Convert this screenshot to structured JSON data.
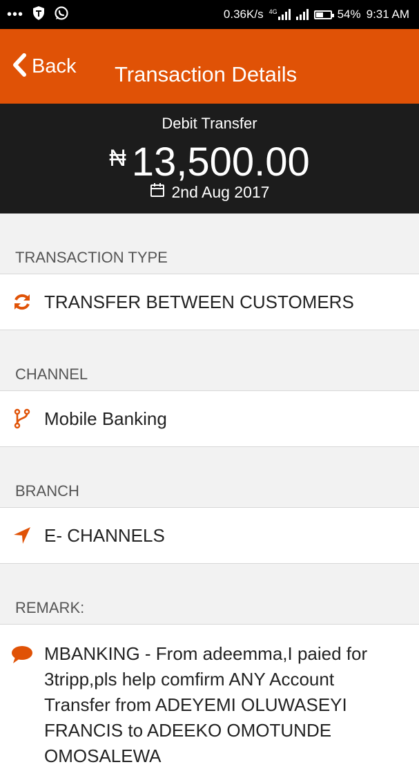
{
  "status_bar": {
    "speed": "0.36K/s",
    "network": "4G",
    "battery": "54%",
    "battery_level": 0.54,
    "time": "9:31 AM",
    "icons": [
      "more-dots-icon",
      "shield-vpn-icon",
      "whatsapp-icon"
    ]
  },
  "app_bar": {
    "back_label": "Back",
    "title": "Transaction Details"
  },
  "summary": {
    "type": "Debit Transfer",
    "currency_symbol": "₦",
    "amount": "13,500.00",
    "date": "2nd Aug 2017"
  },
  "sections": [
    {
      "header": "TRANSACTION TYPE",
      "value": "TRANSFER BETWEEN CUSTOMERS",
      "icon": "refresh-icon"
    },
    {
      "header": "CHANNEL",
      "value": "Mobile Banking",
      "icon": "code-fork-icon"
    },
    {
      "header": "BRANCH",
      "value": "E- CHANNELS",
      "icon": "location-arrow-icon"
    }
  ],
  "remark": {
    "header": "REMARK:",
    "value": "MBANKING - From adeemma,I paied for 3tripp,pls help comfirm ANY Account Transfer from ADEYEMI OLUWASEYI FRANCIS to ADEEKO OMOTUNDE OMOSALEWA",
    "icon": "comment-icon"
  },
  "colors": {
    "accent": "#e05206",
    "summary_bg": "#1c1c1c",
    "section_bg": "#f2f2f2"
  }
}
